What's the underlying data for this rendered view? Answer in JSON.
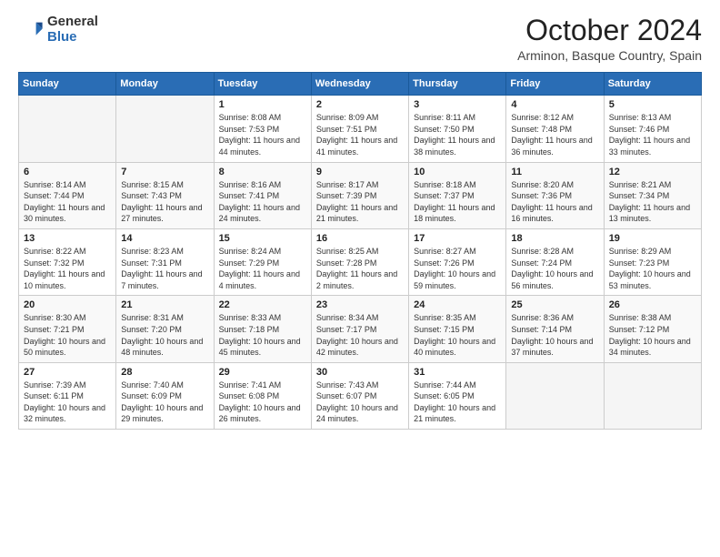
{
  "logo": {
    "general": "General",
    "blue": "Blue"
  },
  "header": {
    "month": "October 2024",
    "location": "Arminon, Basque Country, Spain"
  },
  "weekdays": [
    "Sunday",
    "Monday",
    "Tuesday",
    "Wednesday",
    "Thursday",
    "Friday",
    "Saturday"
  ],
  "weeks": [
    [
      {
        "day": "",
        "empty": true
      },
      {
        "day": "",
        "empty": true
      },
      {
        "day": "1",
        "sunrise": "Sunrise: 8:08 AM",
        "sunset": "Sunset: 7:53 PM",
        "daylight": "Daylight: 11 hours and 44 minutes."
      },
      {
        "day": "2",
        "sunrise": "Sunrise: 8:09 AM",
        "sunset": "Sunset: 7:51 PM",
        "daylight": "Daylight: 11 hours and 41 minutes."
      },
      {
        "day": "3",
        "sunrise": "Sunrise: 8:11 AM",
        "sunset": "Sunset: 7:50 PM",
        "daylight": "Daylight: 11 hours and 38 minutes."
      },
      {
        "day": "4",
        "sunrise": "Sunrise: 8:12 AM",
        "sunset": "Sunset: 7:48 PM",
        "daylight": "Daylight: 11 hours and 36 minutes."
      },
      {
        "day": "5",
        "sunrise": "Sunrise: 8:13 AM",
        "sunset": "Sunset: 7:46 PM",
        "daylight": "Daylight: 11 hours and 33 minutes."
      }
    ],
    [
      {
        "day": "6",
        "sunrise": "Sunrise: 8:14 AM",
        "sunset": "Sunset: 7:44 PM",
        "daylight": "Daylight: 11 hours and 30 minutes."
      },
      {
        "day": "7",
        "sunrise": "Sunrise: 8:15 AM",
        "sunset": "Sunset: 7:43 PM",
        "daylight": "Daylight: 11 hours and 27 minutes."
      },
      {
        "day": "8",
        "sunrise": "Sunrise: 8:16 AM",
        "sunset": "Sunset: 7:41 PM",
        "daylight": "Daylight: 11 hours and 24 minutes."
      },
      {
        "day": "9",
        "sunrise": "Sunrise: 8:17 AM",
        "sunset": "Sunset: 7:39 PM",
        "daylight": "Daylight: 11 hours and 21 minutes."
      },
      {
        "day": "10",
        "sunrise": "Sunrise: 8:18 AM",
        "sunset": "Sunset: 7:37 PM",
        "daylight": "Daylight: 11 hours and 18 minutes."
      },
      {
        "day": "11",
        "sunrise": "Sunrise: 8:20 AM",
        "sunset": "Sunset: 7:36 PM",
        "daylight": "Daylight: 11 hours and 16 minutes."
      },
      {
        "day": "12",
        "sunrise": "Sunrise: 8:21 AM",
        "sunset": "Sunset: 7:34 PM",
        "daylight": "Daylight: 11 hours and 13 minutes."
      }
    ],
    [
      {
        "day": "13",
        "sunrise": "Sunrise: 8:22 AM",
        "sunset": "Sunset: 7:32 PM",
        "daylight": "Daylight: 11 hours and 10 minutes."
      },
      {
        "day": "14",
        "sunrise": "Sunrise: 8:23 AM",
        "sunset": "Sunset: 7:31 PM",
        "daylight": "Daylight: 11 hours and 7 minutes."
      },
      {
        "day": "15",
        "sunrise": "Sunrise: 8:24 AM",
        "sunset": "Sunset: 7:29 PM",
        "daylight": "Daylight: 11 hours and 4 minutes."
      },
      {
        "day": "16",
        "sunrise": "Sunrise: 8:25 AM",
        "sunset": "Sunset: 7:28 PM",
        "daylight": "Daylight: 11 hours and 2 minutes."
      },
      {
        "day": "17",
        "sunrise": "Sunrise: 8:27 AM",
        "sunset": "Sunset: 7:26 PM",
        "daylight": "Daylight: 10 hours and 59 minutes."
      },
      {
        "day": "18",
        "sunrise": "Sunrise: 8:28 AM",
        "sunset": "Sunset: 7:24 PM",
        "daylight": "Daylight: 10 hours and 56 minutes."
      },
      {
        "day": "19",
        "sunrise": "Sunrise: 8:29 AM",
        "sunset": "Sunset: 7:23 PM",
        "daylight": "Daylight: 10 hours and 53 minutes."
      }
    ],
    [
      {
        "day": "20",
        "sunrise": "Sunrise: 8:30 AM",
        "sunset": "Sunset: 7:21 PM",
        "daylight": "Daylight: 10 hours and 50 minutes."
      },
      {
        "day": "21",
        "sunrise": "Sunrise: 8:31 AM",
        "sunset": "Sunset: 7:20 PM",
        "daylight": "Daylight: 10 hours and 48 minutes."
      },
      {
        "day": "22",
        "sunrise": "Sunrise: 8:33 AM",
        "sunset": "Sunset: 7:18 PM",
        "daylight": "Daylight: 10 hours and 45 minutes."
      },
      {
        "day": "23",
        "sunrise": "Sunrise: 8:34 AM",
        "sunset": "Sunset: 7:17 PM",
        "daylight": "Daylight: 10 hours and 42 minutes."
      },
      {
        "day": "24",
        "sunrise": "Sunrise: 8:35 AM",
        "sunset": "Sunset: 7:15 PM",
        "daylight": "Daylight: 10 hours and 40 minutes."
      },
      {
        "day": "25",
        "sunrise": "Sunrise: 8:36 AM",
        "sunset": "Sunset: 7:14 PM",
        "daylight": "Daylight: 10 hours and 37 minutes."
      },
      {
        "day": "26",
        "sunrise": "Sunrise: 8:38 AM",
        "sunset": "Sunset: 7:12 PM",
        "daylight": "Daylight: 10 hours and 34 minutes."
      }
    ],
    [
      {
        "day": "27",
        "sunrise": "Sunrise: 7:39 AM",
        "sunset": "Sunset: 6:11 PM",
        "daylight": "Daylight: 10 hours and 32 minutes."
      },
      {
        "day": "28",
        "sunrise": "Sunrise: 7:40 AM",
        "sunset": "Sunset: 6:09 PM",
        "daylight": "Daylight: 10 hours and 29 minutes."
      },
      {
        "day": "29",
        "sunrise": "Sunrise: 7:41 AM",
        "sunset": "Sunset: 6:08 PM",
        "daylight": "Daylight: 10 hours and 26 minutes."
      },
      {
        "day": "30",
        "sunrise": "Sunrise: 7:43 AM",
        "sunset": "Sunset: 6:07 PM",
        "daylight": "Daylight: 10 hours and 24 minutes."
      },
      {
        "day": "31",
        "sunrise": "Sunrise: 7:44 AM",
        "sunset": "Sunset: 6:05 PM",
        "daylight": "Daylight: 10 hours and 21 minutes."
      },
      {
        "day": "",
        "empty": true
      },
      {
        "day": "",
        "empty": true
      }
    ]
  ]
}
